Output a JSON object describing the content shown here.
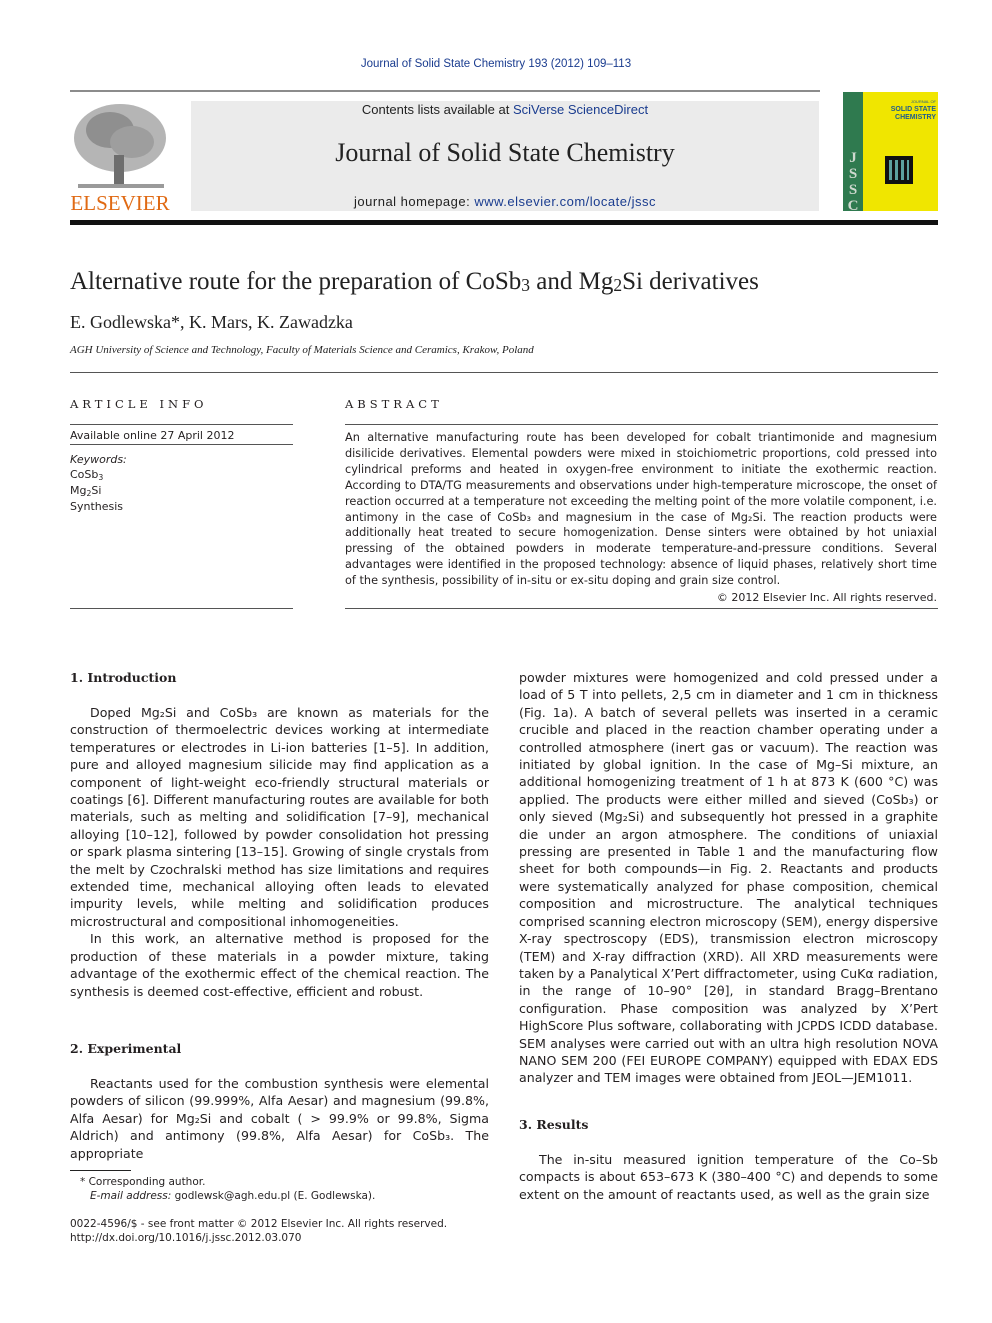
{
  "header": {
    "citation": "Journal of Solid State Chemistry 193 (2012) 109–113",
    "contents_prefix": "Contents lists available at ",
    "contents_link": "SciVerse ScienceDirect",
    "journal_name": "Journal of Solid State Chemistry",
    "homepage_prefix": "journal homepage: ",
    "homepage_link": "www.elsevier.com/locate/jssc",
    "publisher_logo_text": "ELSEVIER",
    "cover": {
      "top_text": "JOURNAL OF",
      "title_line1": "SOLID STATE",
      "title_line2": "CHEMISTRY",
      "spine": "JSSC",
      "bg_color": "#f0e600",
      "spine_color": "#2f7a4f"
    }
  },
  "article": {
    "title_parts": [
      "Alternative route for the preparation of CoSb",
      "3",
      " and Mg",
      "2",
      "Si derivatives"
    ],
    "authors": "E. Godlewska*, K. Mars, K. Zawadzka",
    "affiliation": "AGH University of Science and Technology, Faculty of Materials Science and Ceramics, Krakow, Poland"
  },
  "article_info": {
    "heading": "ARTICLE INFO",
    "available": "Available online 27 April 2012",
    "keywords_label": "Keywords:",
    "keywords": [
      {
        "base": "CoSb",
        "sub": "3",
        "rest": ""
      },
      {
        "base": "Mg",
        "sub": "2",
        "rest": "Si"
      },
      {
        "base": "Synthesis",
        "sub": "",
        "rest": ""
      }
    ]
  },
  "abstract": {
    "heading": "ABSTRACT",
    "text": "An alternative manufacturing route has been developed for cobalt triantimonide and magnesium disilicide derivatives. Elemental powders were mixed in stoichiometric proportions, cold pressed into cylindrical preforms and heated in oxygen-free environment to initiate the exothermic reaction. According to DTA/TG measurements and observations under high-temperature microscope, the onset of reaction occurred at a temperature not exceeding the melting point of the more volatile component, i.e. antimony in the case of CoSb₃ and magnesium in the case of Mg₂Si. The reaction products were additionally heat treated to secure homogenization. Dense sinters were obtained by hot uniaxial pressing of the obtained powders in moderate temperature-and-pressure conditions. Several advantages were identified in the proposed technology: absence of liquid phases, relatively short time of the synthesis, possibility of in-situ or ex-situ doping and grain size control.",
    "copyright": "© 2012 Elsevier Inc. All rights reserved."
  },
  "sections": {
    "intro_heading": "1.  Introduction",
    "intro_p1": "Doped Mg₂Si and CoSb₃ are known as materials for the construction of thermoelectric devices working at intermediate temperatures or electrodes in Li-ion batteries [1–5]. In addition, pure and alloyed magnesium silicide may find application as a component of light-weight eco-friendly structural materials or coatings [6]. Different manufacturing routes are available for both materials, such as melting and solidification [7–9], mechanical alloying [10–12], followed by powder consolidation hot pressing or spark plasma sintering [13–15]. Growing of single crystals from the melt by Czochralski method has size limitations and requires extended time, mechanical alloying often leads to elevated impurity levels, while melting and solidification produces microstructural and compositional inhomogeneities.",
    "intro_p2": "In this work, an alternative method is proposed for the production of these materials in a powder mixture, taking advantage of the exothermic effect of the chemical reaction. The synthesis is deemed cost-effective, efficient and robust.",
    "exp_heading": "2.  Experimental",
    "exp_p1_left": "Reactants used for the combustion synthesis were elemental powders of silicon (99.999%, Alfa Aesar) and magnesium (99.8%, Alfa Aesar) for Mg₂Si and cobalt ( > 99.9% or 99.8%, Sigma Aldrich) and antimony (99.8%, Alfa Aesar) for CoSb₃. The appropriate",
    "exp_p1_right": "powder mixtures were homogenized and cold pressed under a load of 5 T into pellets, 2,5 cm in diameter and 1 cm in thickness (Fig. 1a). A batch of several pellets was inserted in a ceramic crucible and placed in the reaction chamber operating under a controlled atmosphere (inert gas or vacuum). The reaction was initiated by global ignition. In the case of Mg–Si mixture, an additional homogenizing treatment of 1 h at 873 K (600 °C) was applied. The products were either milled and sieved (CoSb₃) or only sieved (Mg₂Si) and subsequently hot pressed in a graphite die under an argon atmosphere. The conditions of uniaxial pressing are presented in Table 1 and the manufacturing flow sheet for both compounds—in Fig. 2. Reactants and products were systematically analyzed for phase composition, chemical composition and microstructure. The analytical techniques comprised scanning electron microscopy (SEM), energy dispersive X-ray spectroscopy (EDS), transmission electron microscopy (TEM) and X-ray diffraction (XRD). All XRD measurements were taken by a Panalytical X’Pert diffractometer, using CuKα radiation, in the range of 10–90° [2θ], in standard Bragg–Brentano configuration. Phase composition was analyzed by X’Pert HighScore Plus software, collaborating with JCPDS ICDD database. SEM analyses were carried out with an ultra high resolution NOVA NANO SEM 200 (FEI EUROPE COMPANY) equipped with EDAX EDS analyzer and TEM images were obtained from JEOL—JEM1011.",
    "results_heading": "3.  Results",
    "results_p1": "The in-situ measured ignition temperature of the Co–Sb compacts is about 653–673 K (380–400 °C) and depends to some extent on the amount of reactants used, as well as the grain size"
  },
  "footnotes": {
    "corresponding": "* Corresponding author.",
    "email_label": "E-mail address:",
    "email": " godlewsk@agh.edu.pl (E. Godlewska).",
    "issn": "0022-4596/$ - see front matter © 2012 Elsevier Inc. All rights reserved.",
    "doi": "http://dx.doi.org/10.1016/j.jssc.2012.03.070"
  }
}
